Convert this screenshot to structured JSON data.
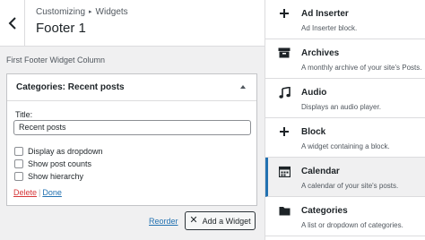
{
  "header": {
    "breadcrumb_root": "Customizing",
    "breadcrumb_section": "Widgets",
    "title": "Footer 1"
  },
  "column_name": "First Footer Widget Column",
  "widget": {
    "title": "Categories: Recent posts",
    "field_label": "Title:",
    "field_value": "Recent posts",
    "options": [
      "Display as dropdown",
      "Show post counts",
      "Show hierarchy"
    ],
    "delete_label": "Delete",
    "separator": "|",
    "done_label": "Done"
  },
  "footer": {
    "reorder_label": "Reorder",
    "add_widget_label": "Add a Widget"
  },
  "available_widgets": [
    {
      "name": "Ad Inserter",
      "desc": "Ad Inserter block.",
      "icon": "plus-icon"
    },
    {
      "name": "Archives",
      "desc": "A monthly archive of your site's Posts.",
      "icon": "archive-icon"
    },
    {
      "name": "Audio",
      "desc": "Displays an audio player.",
      "icon": "music-note-icon"
    },
    {
      "name": "Block",
      "desc": "A widget containing a block.",
      "icon": "plus-icon"
    },
    {
      "name": "Calendar",
      "desc": "A calendar of your site's posts.",
      "icon": "calendar-icon"
    },
    {
      "name": "Categories",
      "desc": "A list or dropdown of categories.",
      "icon": "folder-icon"
    }
  ],
  "colors": {
    "accent": "#2271b1",
    "delete": "#d63638",
    "panel_bg": "#f0f0f1"
  }
}
